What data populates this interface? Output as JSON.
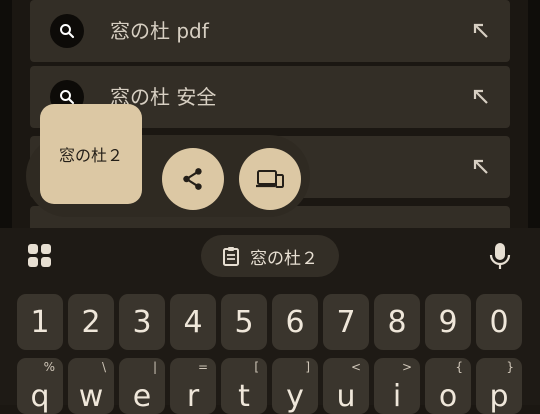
{
  "suggestions": [
    {
      "text": "窓の杜 pdf"
    },
    {
      "text": "窓の杜 安全"
    }
  ],
  "popup": {
    "preview_text": "窓の杜２",
    "share_icon": "share-icon",
    "device_icon": "send-to-device-icon"
  },
  "toolbar": {
    "grid_icon": "apps-grid-icon",
    "clipboard_text": "窓の杜２",
    "clipboard_icon": "clipboard-icon",
    "mic_icon": "microphone-icon"
  },
  "number_row": [
    "1",
    "2",
    "3",
    "4",
    "5",
    "6",
    "7",
    "8",
    "9",
    "0"
  ],
  "letter_row": [
    {
      "key": "q",
      "hint": "%"
    },
    {
      "key": "w",
      "hint": "\\"
    },
    {
      "key": "e",
      "hint": "|"
    },
    {
      "key": "r",
      "hint": "="
    },
    {
      "key": "t",
      "hint": "["
    },
    {
      "key": "y",
      "hint": "]"
    },
    {
      "key": "u",
      "hint": "<"
    },
    {
      "key": "i",
      "hint": ">"
    },
    {
      "key": "o",
      "hint": "{"
    },
    {
      "key": "p",
      "hint": "}"
    }
  ],
  "colors": {
    "background": "#1b1712",
    "card": "#332e26",
    "accent": "#dcc8a4",
    "key": "#3a352d"
  }
}
